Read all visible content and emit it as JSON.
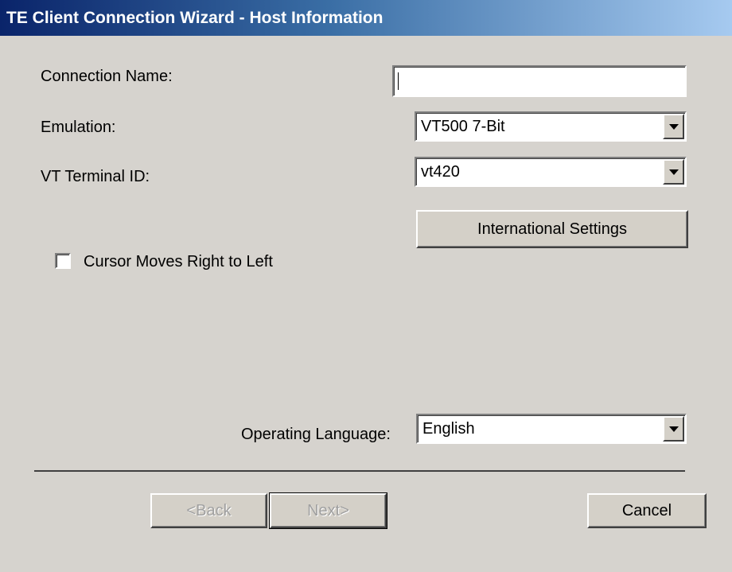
{
  "window": {
    "title": "TE Client Connection Wizard - Host Information"
  },
  "form": {
    "connection_name": {
      "label": "Connection Name:",
      "value": ""
    },
    "emulation": {
      "label": "Emulation:",
      "value": "VT500 7-Bit"
    },
    "terminal_id": {
      "label": "VT Terminal ID:",
      "value": "vt420"
    },
    "international_settings_label": "International Settings",
    "cursor_rtl": {
      "label": "Cursor Moves Right to Left",
      "checked": false
    },
    "operating_language": {
      "label": "Operating Language:",
      "value": "English"
    }
  },
  "buttons": {
    "back": "<Back",
    "next": "Next>",
    "cancel": "Cancel"
  },
  "icons": [
    "dropdown-arrow-icon"
  ]
}
